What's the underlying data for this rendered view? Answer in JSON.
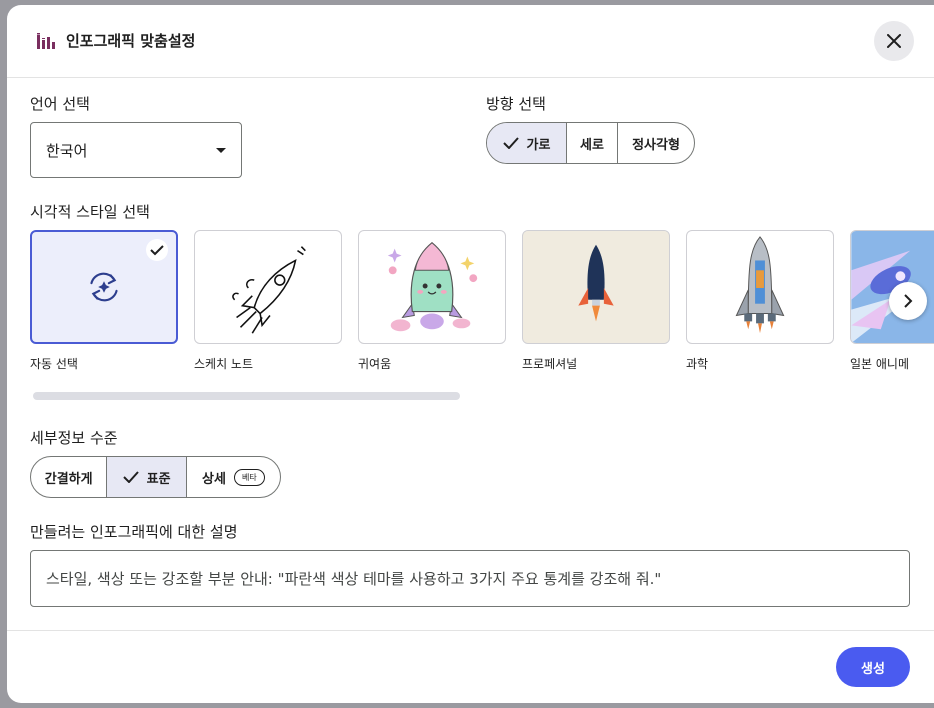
{
  "dialog": {
    "title": "인포그래픽 맞춤설정",
    "header_icon": "bar-chart-icon",
    "close_icon": "close-icon"
  },
  "language": {
    "label": "언어 선택",
    "selected": "한국어"
  },
  "orientation": {
    "label": "방향 선택",
    "options": [
      "가로",
      "세로",
      "정사각형"
    ],
    "selected": "가로"
  },
  "visual_style": {
    "label": "시각적 스타일 선택",
    "options": [
      "자동 선택",
      "스케치 노트",
      "귀여움",
      "프로페셔널",
      "과학",
      "일본 애니메"
    ],
    "selected": "자동 선택",
    "next_icon": "chevron-right-icon"
  },
  "detail_level": {
    "label": "세부정보 수준",
    "options": [
      "간결하게",
      "표준",
      "상세"
    ],
    "selected": "표준",
    "beta_badge": "베타"
  },
  "description": {
    "label": "만들려는 인포그래픽에 대한 설명",
    "placeholder": "스타일, 색상 또는 강조할 부분 안내: \"파란색 색상 테마를 사용하고 3가지 주요 통계를 강조해 줘.\""
  },
  "footer": {
    "generate_label": "생성"
  },
  "colors": {
    "accent": "#4a5bf0",
    "selected_bg": "#e7e8f4",
    "header_icon": "#7a2e5f"
  }
}
